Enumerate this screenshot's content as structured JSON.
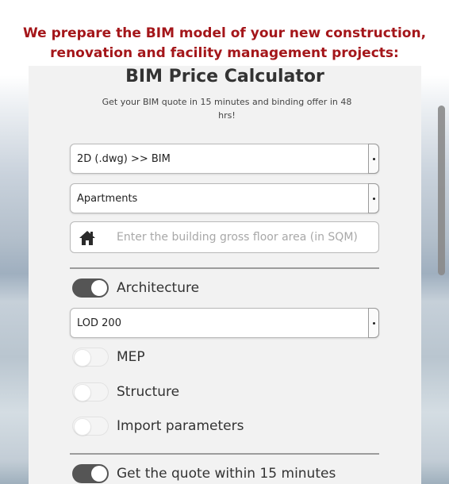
{
  "headline": {
    "line1": "We prepare the BIM model of your new construction,",
    "line2": "renovation and facility management projects:"
  },
  "calculator": {
    "title": "BIM Price Calculator",
    "subtitle_line1": "Get your BIM quote in 15 minutes and binding offer in 48",
    "subtitle_line2": "hrs!",
    "conversion_select": {
      "value": "2D (.dwg) >> BIM"
    },
    "building_type_select": {
      "value": "Apartments"
    },
    "area_input": {
      "icon": "home-icon",
      "placeholder": "Enter the building gross floor area (in SQM)",
      "value": ""
    },
    "architecture_toggle": {
      "label": "Architecture",
      "on": true
    },
    "lod_select": {
      "value": "LOD 200"
    },
    "mep_toggle": {
      "label": "MEP",
      "on": false
    },
    "structure_toggle": {
      "label": "Structure",
      "on": false
    },
    "import_toggle": {
      "label": "Import parameters",
      "on": false
    },
    "quote_toggle": {
      "label": "Get the quote within 15 minutes",
      "on": true
    }
  },
  "colors": {
    "headline": "#a4161a",
    "panel": "#f2f2f2",
    "toggle_on": "#555555",
    "toggle_off": "#f4f4f4"
  }
}
